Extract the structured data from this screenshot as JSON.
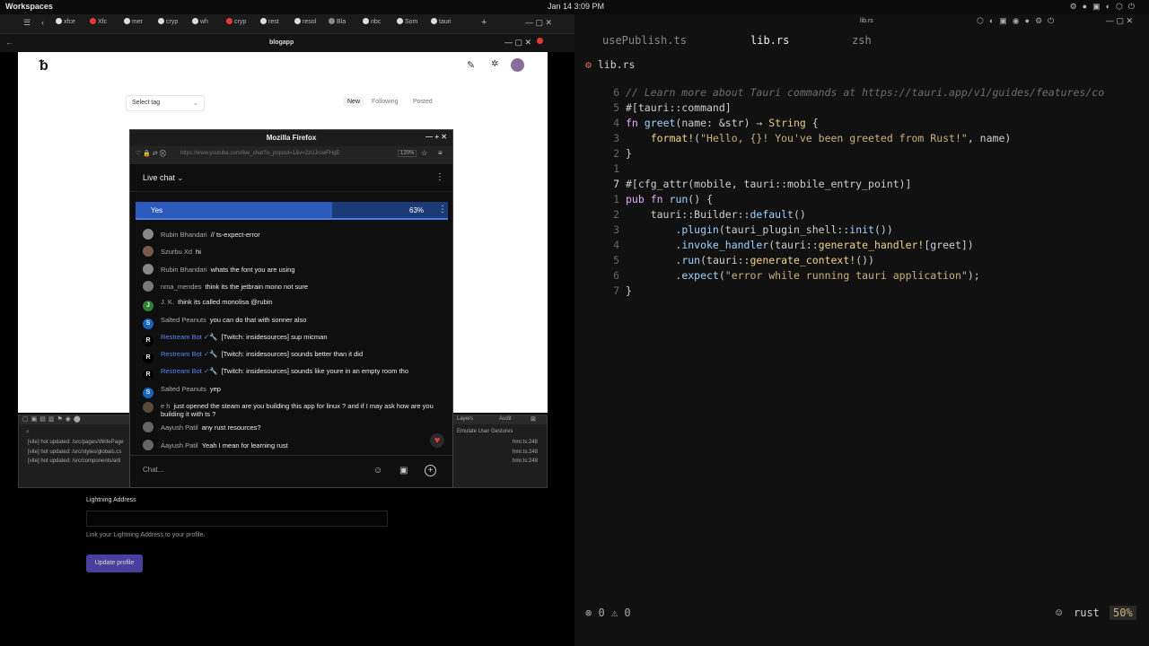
{
  "topbar": {
    "workspace": "Workspaces",
    "clock": "Jan 14  3:09 PM"
  },
  "browser": {
    "tabs": [
      {
        "label": "xfce",
        "color": "#e0e0e0"
      },
      {
        "label": "Xfc",
        "color": "#e53935"
      },
      {
        "label": "mer",
        "color": "#ddd"
      },
      {
        "label": "cryp",
        "color": "#ddd"
      },
      {
        "label": "wh",
        "color": "#ddd"
      },
      {
        "label": "cryp",
        "color": "#e53935"
      },
      {
        "label": "rest",
        "color": "#ddd"
      },
      {
        "label": "resol",
        "color": "#ddd"
      },
      {
        "label": "Bla",
        "color": "#888"
      },
      {
        "label": "nbc",
        "color": "#ddd"
      },
      {
        "label": "Som",
        "color": "#ddd"
      },
      {
        "label": "tauri",
        "color": "#ddd"
      }
    ],
    "app_title": "blogapp"
  },
  "blog": {
    "select_tag": "Select tag",
    "filters": [
      "New",
      "Following",
      "Posted"
    ],
    "lightning_label": "Lightning Address",
    "lightning_help": "Link your Lightning Address to your profile.",
    "update_button": "Update profile"
  },
  "devtools": {
    "panels": [
      "Layers",
      "Audit",
      "Emulate User Gestures"
    ],
    "logs": [
      {
        "text": "[vite] hot updated: /src/pages/WritePage",
        "loc": "hmr.ts:248"
      },
      {
        "text": "[vite] hot updated: /src/styles/globals.cs",
        "loc": "hmr.ts:248"
      },
      {
        "text": "[vite] hot updated: /src/components/arti",
        "loc": "hmr.ts:248"
      }
    ]
  },
  "firefox": {
    "title": "Mozilla Firefox",
    "url": "https://www.youtube.com/live_chat?is_popout=1&v=2zUJrowFHgE",
    "zoom": "120%",
    "live_chat": "Live chat",
    "poll": {
      "option": "Yes",
      "percent_label": "63%",
      "percent": 0.63
    },
    "messages": [
      {
        "author": "Rubin Bhandari",
        "text": "// ts-expect-error",
        "av": "#888",
        "init": "",
        "mod": false
      },
      {
        "author": "Szurbu Xd",
        "text": "hi",
        "av": "#7a5a4a",
        "init": "",
        "mod": false
      },
      {
        "author": "Rubin Bhandari",
        "text": "whats the font you are using",
        "av": "#888",
        "init": "",
        "mod": false
      },
      {
        "author": "nma_mendes",
        "text": "think its the jetbrain mono not sure",
        "av": "#777",
        "init": "",
        "mod": false
      },
      {
        "author": "J. K.",
        "text": "think its called monolisa @rubin",
        "av": "#2e7d32",
        "init": "J",
        "mod": false
      },
      {
        "author": "Salted Peanuts",
        "text": "you can do that with sonner also",
        "av": "#1565c0",
        "init": "S",
        "mod": false
      },
      {
        "author": "Restream Bot ✓🔧",
        "text": "[Twitch: insidesources] sup micman",
        "av": "#000",
        "init": "R",
        "mod": true
      },
      {
        "author": "Restream Bot ✓🔧",
        "text": "[Twitch: insidesources] sounds better than it did",
        "av": "#000",
        "init": "R",
        "mod": true
      },
      {
        "author": "Restream Bot ✓🔧",
        "text": "[Twitch: insidesources] sounds like youre in an empty room tho",
        "av": "#000",
        "init": "R",
        "mod": true
      },
      {
        "author": "Salted Peanuts",
        "text": "yep",
        "av": "#1565c0",
        "init": "S",
        "mod": false
      },
      {
        "author": "e h",
        "text": "just opened the steam are you building this app for linux ? and if I may ask how are you building it with ts ?",
        "av": "#5a4a3a",
        "init": "",
        "mod": false
      },
      {
        "author": "Aayush Patil",
        "text": "any rust resources?",
        "av": "#666",
        "init": "",
        "mod": false
      },
      {
        "author": "Aayush Patil",
        "text": "Yeah I mean for learning rust",
        "av": "#666",
        "init": "",
        "mod": false
      }
    ],
    "chat_placeholder": "Chat..."
  },
  "editor": {
    "window_title": "lib.rs",
    "tabs": [
      "usePublish.ts",
      "lib.rs",
      "zsh"
    ],
    "file": "lib.rs",
    "lines": [
      {
        "n": "6",
        "code": "// Learn more about Tauri commands at https://tauri.app/v1/guides/features/co"
      },
      {
        "n": "5",
        "code": "#[tauri::command]"
      },
      {
        "n": "4",
        "code": "fn greet(name: &str) → String {"
      },
      {
        "n": "3",
        "code": "    format!(\"Hello, {}! You've been greeted from Rust!\", name)"
      },
      {
        "n": "2",
        "code": "}"
      },
      {
        "n": "1",
        "code": ""
      },
      {
        "n": "7",
        "code": "#[cfg_attr(mobile, tauri::mobile_entry_point)]"
      },
      {
        "n": "1",
        "code": "pub fn run() {"
      },
      {
        "n": "2",
        "code": "    tauri::Builder::default()"
      },
      {
        "n": "3",
        "code": "        .plugin(tauri_plugin_shell::init())"
      },
      {
        "n": "4",
        "code": "        .invoke_handler(tauri::generate_handler![greet])"
      },
      {
        "n": "5",
        "code": "        .run(tauri::generate_context!())"
      },
      {
        "n": "6",
        "code": "        .expect(\"error while running tauri application\");"
      },
      {
        "n": "7",
        "code": "}"
      }
    ],
    "status": {
      "errors": "0",
      "warnings": "0",
      "lang": "rust",
      "zoom": "50%"
    }
  }
}
